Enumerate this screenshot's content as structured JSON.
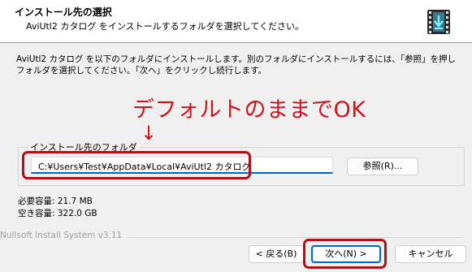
{
  "header": {
    "title": "インストール先の選択",
    "subtitle": "AviUtl2 カタログ をインストールするフォルダを選択してください。",
    "icon": "installer-icon"
  },
  "description": "AviUtl2 カタログ を以下のフォルダにインストールします。別のフォルダにインストールするには、「参照」を押しフォルダを選択してください。「次へ」をクリックし続行します。",
  "annotation": {
    "text": "デフォルトのままでOK",
    "arrow": "↓",
    "color": "#d0131c"
  },
  "destination": {
    "group_label": "インストール先のフォルダ",
    "path": "C:¥Users¥Test¥AppData¥Local¥AviUtl2 カタログ",
    "browse_label": "参照(R)..."
  },
  "space": {
    "required": "必要容量: 21.7 MB",
    "available": "空き容量: 322.0 GB"
  },
  "brand": "Nullsoft Install System v3.11",
  "buttons": {
    "back": "< 戻る(B)",
    "next": "次へ(N) >",
    "cancel": "キャンセル"
  },
  "colors": {
    "accent": "#0067c0",
    "highlight": "#b01017"
  }
}
